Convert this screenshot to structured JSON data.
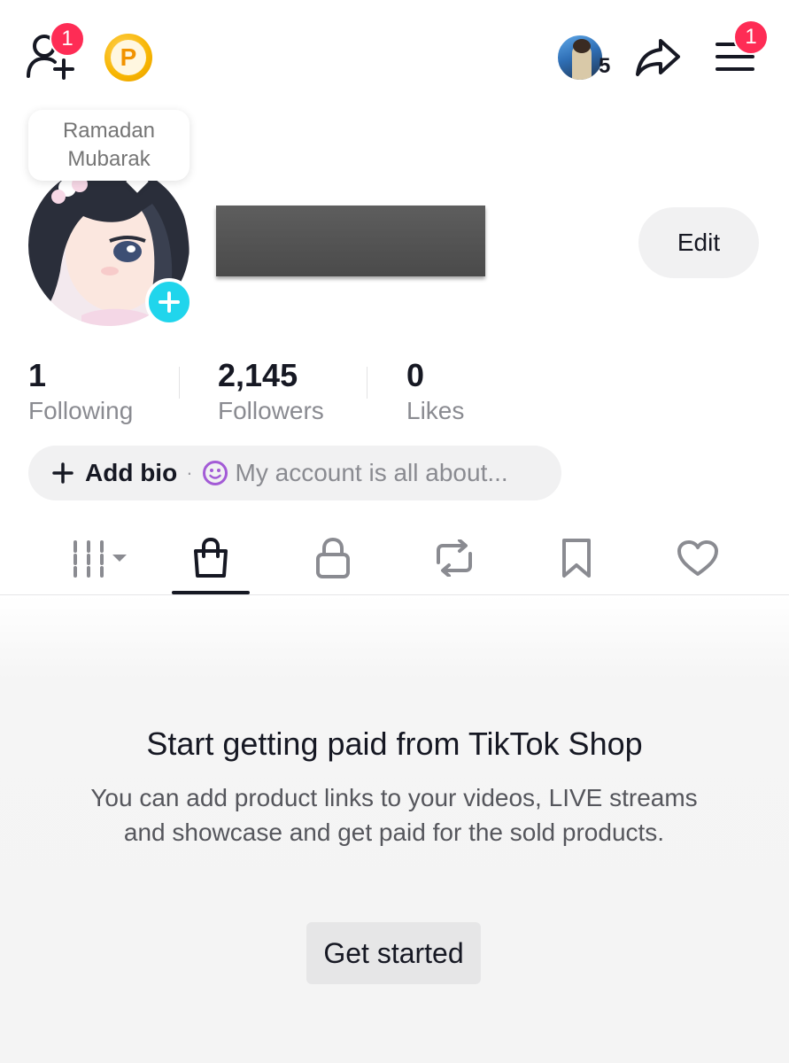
{
  "header": {
    "add_friend_badge": "1",
    "coin_letter": "P",
    "story_viewer_count": "5",
    "menu_badge": "1"
  },
  "profile": {
    "greeting_bubble_line1": "Ramadan",
    "greeting_bubble_line2": "Mubarak",
    "edit_label": "Edit"
  },
  "stats": [
    {
      "value": "1",
      "label": "Following"
    },
    {
      "value": "2,145",
      "label": "Followers"
    },
    {
      "value": "0",
      "label": "Likes"
    }
  ],
  "bio": {
    "add_label": "Add bio",
    "separator": "·",
    "placeholder": "My account is all about..."
  },
  "tabs": [
    {
      "name": "videos",
      "icon": "grid-icon",
      "active": false
    },
    {
      "name": "shop",
      "icon": "shopping-bag-icon",
      "active": true
    },
    {
      "name": "private",
      "icon": "lock-icon",
      "active": false
    },
    {
      "name": "reposts",
      "icon": "repost-icon",
      "active": false
    },
    {
      "name": "favorites",
      "icon": "bookmark-icon",
      "active": false
    },
    {
      "name": "liked",
      "icon": "heart-icon",
      "active": false
    }
  ],
  "shop_empty": {
    "title": "Start getting paid from TikTok Shop",
    "description": "You can add product links to your videos, LIVE streams and showcase and get paid for the sold products.",
    "button_label": "Get started"
  },
  "colors": {
    "badge": "#fe2c55",
    "add_avatar": "#20d5ec",
    "coin": "#f7b500",
    "text_primary": "#161823",
    "text_secondary": "#8a8b91",
    "emoji_accent": "#a35bd6"
  }
}
